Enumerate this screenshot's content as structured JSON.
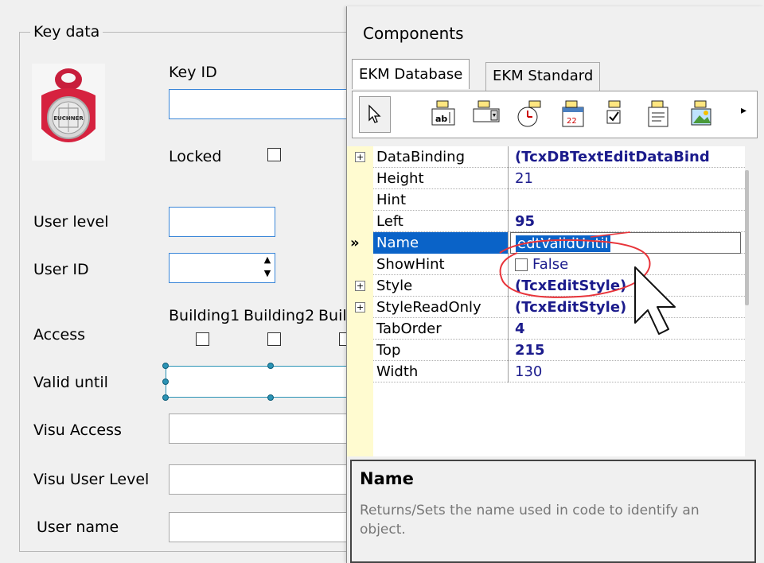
{
  "form": {
    "group_title": "Key data",
    "key_id_label": "Key ID",
    "locked_label": "Locked",
    "user_level_label": "User level",
    "user_id_label": "User ID",
    "access_label": "Access",
    "building1": "Building1",
    "building2": "Building2",
    "building3": "Build",
    "valid_until_label": "Valid until",
    "visu_access_label": "Visu Access",
    "visu_user_level_label": "Visu User Level",
    "user_name_label": "User name",
    "key_logo_text": "EUCHNER"
  },
  "components": {
    "title": "Components",
    "tabs": [
      "EKM Database",
      "EKM Standard"
    ],
    "toolbar_icons": [
      "pointer-icon",
      "db-text-edit-icon",
      "db-combo-icon",
      "db-time-edit-icon",
      "db-date-edit-icon",
      "db-checkbox-icon",
      "db-memo-icon",
      "db-image-icon",
      "more-arrow-icon"
    ]
  },
  "properties": [
    {
      "name": "DataBinding",
      "value": "(TcxDBTextEditDataBind",
      "bold": true,
      "expandable": true
    },
    {
      "name": "Height",
      "value": "21",
      "bold": false
    },
    {
      "name": "Hint",
      "value": "",
      "bold": false
    },
    {
      "name": "Left",
      "value": "95",
      "bold": true
    },
    {
      "name": "Name",
      "value": "edtValidUntil",
      "bold": false,
      "selected": true
    },
    {
      "name": "ShowHint",
      "value": "False",
      "bold": false,
      "checkbox": true
    },
    {
      "name": "Style",
      "value": "(TcxEditStyle)",
      "bold": true,
      "expandable": true
    },
    {
      "name": "StyleReadOnly",
      "value": "(TcxEditStyle)",
      "bold": true,
      "expandable": true
    },
    {
      "name": "TabOrder",
      "value": "4",
      "bold": true
    },
    {
      "name": "Top",
      "value": "215",
      "bold": true
    },
    {
      "name": "Width",
      "value": "130",
      "bold": false
    }
  ],
  "description": {
    "title": "Name",
    "text": "Returns/Sets the name used in code to identify an object."
  },
  "colors": {
    "selection": "#0a63c8",
    "gutter": "#fffbd0",
    "value_text": "#1b1b8c",
    "highlight_circle": "#e8343a"
  }
}
